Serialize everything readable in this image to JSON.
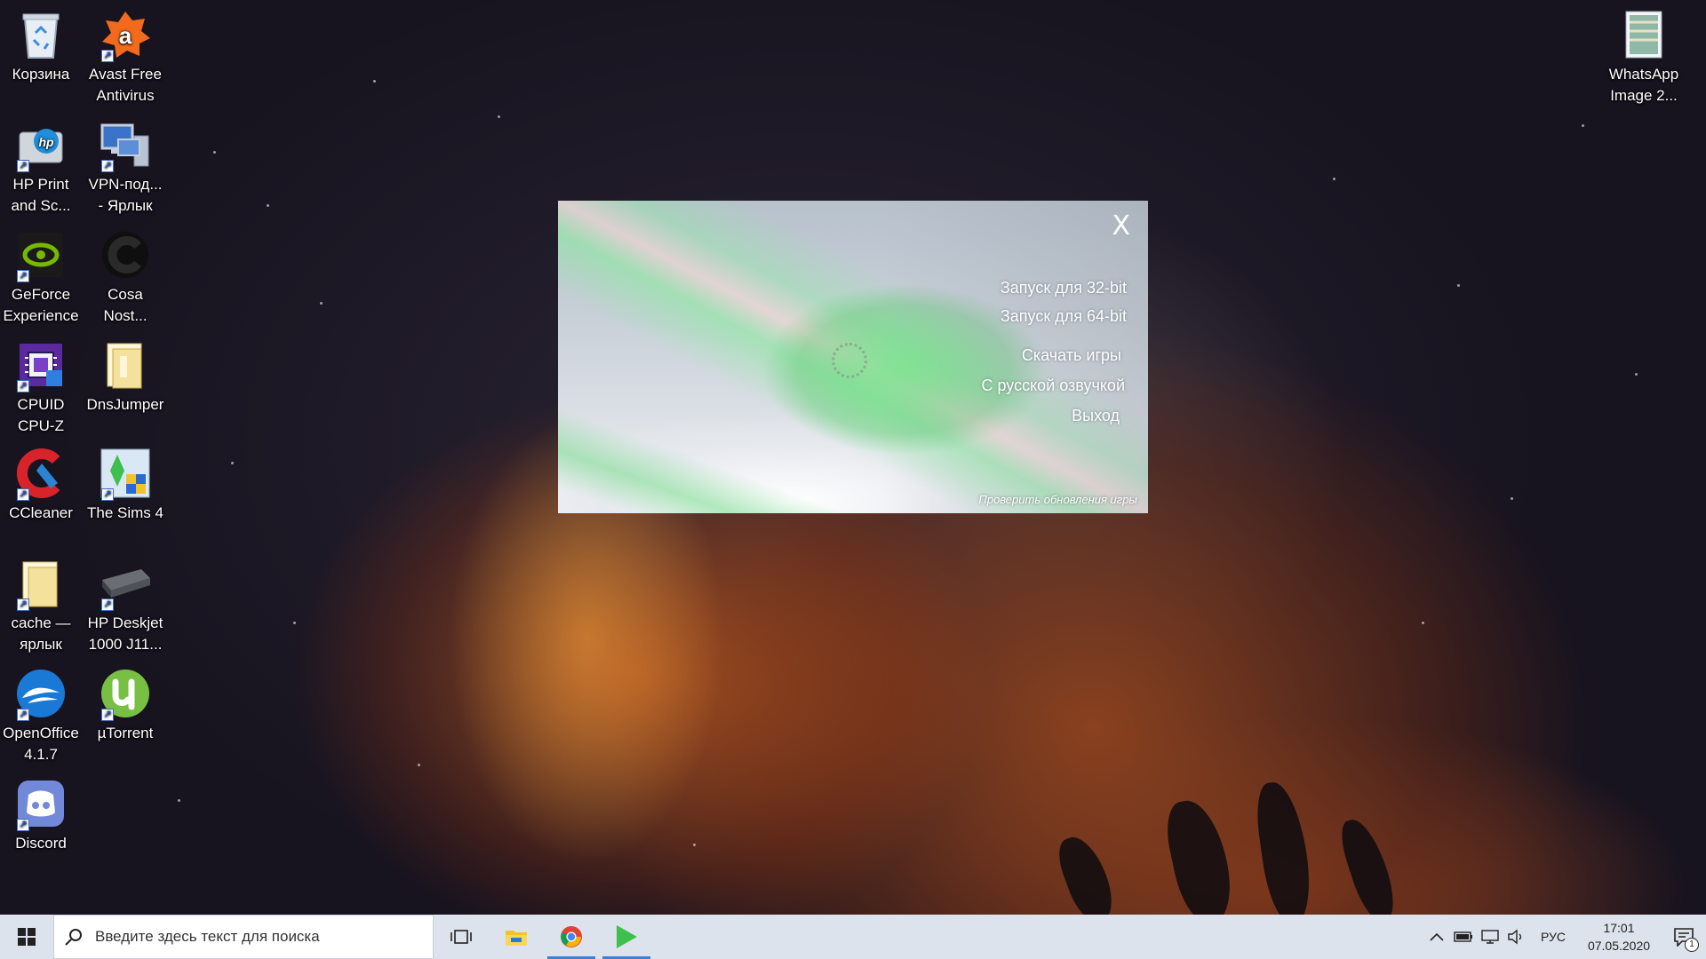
{
  "desktop": {
    "icons_left": [
      {
        "label": "Корзина",
        "icon": "recycle-bin-icon"
      },
      {
        "label": "Avast Free Antivirus",
        "icon": "avast-icon"
      },
      {
        "label": "HP Print and Sc...",
        "icon": "hp-print-icon"
      },
      {
        "label": "VPN-под... - Ярлык",
        "icon": "vpn-computer-icon"
      },
      {
        "label": "GeForce Experience",
        "icon": "geforce-icon"
      },
      {
        "label": "Cosa Nost...",
        "icon": "cosa-nostra-icon"
      },
      {
        "label": "CPUID CPU-Z",
        "icon": "cpuz-icon"
      },
      {
        "label": "DnsJumper",
        "icon": "folder-icon"
      },
      {
        "label": "CCleaner",
        "icon": "ccleaner-icon"
      },
      {
        "label": "The Sims 4",
        "icon": "sims-icon"
      },
      {
        "label": "cache — ярлык",
        "icon": "folder-icon"
      },
      {
        "label": "HP Deskjet 1000 J11...",
        "icon": "printer-icon"
      },
      {
        "label": "OpenOffice 4.1.7",
        "icon": "openoffice-icon"
      },
      {
        "label": "µTorrent",
        "icon": "utorrent-icon"
      },
      {
        "label": "Discord",
        "icon": "discord-icon"
      }
    ],
    "icon_right": {
      "label": "WhatsApp Image 2...",
      "icon": "image-file-icon"
    }
  },
  "launcher": {
    "close_label": "X",
    "menu": [
      "Запуск для 32-bit",
      "Запуск для 64-bit",
      "Скачать игры",
      "С русской озвучкой",
      "Выход"
    ],
    "update_link": "Проверить обновления игры"
  },
  "taskbar": {
    "search_placeholder": "Введите здесь текст для поиска",
    "apps": [
      "task-view-icon",
      "file-explorer-icon",
      "chrome-icon",
      "launcher-play-icon"
    ],
    "tray": {
      "language": "РУС",
      "time": "17:01",
      "date": "07.05.2020",
      "notification_count": "1"
    }
  },
  "colors": {
    "accent": "#3b82d6",
    "taskbar_bg": "#dde3ec"
  }
}
